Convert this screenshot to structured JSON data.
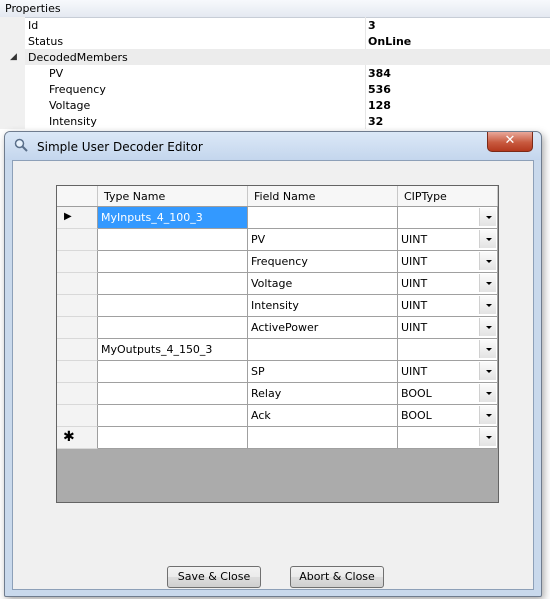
{
  "properties": {
    "header": "Properties",
    "rows": [
      {
        "name": "Id",
        "value": "3"
      },
      {
        "name": "Status",
        "value": "OnLine"
      },
      {
        "name": "DecodedMembers",
        "value": ""
      },
      {
        "name": "PV",
        "value": "384"
      },
      {
        "name": "Frequency",
        "value": "536"
      },
      {
        "name": "Voltage",
        "value": "128"
      },
      {
        "name": "Intensity",
        "value": "32"
      }
    ]
  },
  "dialog": {
    "title": "Simple User Decoder Editor",
    "close_label": "✕",
    "grid": {
      "columns": [
        "Type Name",
        "Field Name",
        "CIPType"
      ],
      "rows": [
        {
          "type_name": "MyInputs_4_100_3",
          "field_name": "",
          "cip_type": "",
          "marker": "▶"
        },
        {
          "type_name": "",
          "field_name": "PV",
          "cip_type": "UINT",
          "marker": ""
        },
        {
          "type_name": "",
          "field_name": "Frequency",
          "cip_type": "UINT",
          "marker": ""
        },
        {
          "type_name": "",
          "field_name": "Voltage",
          "cip_type": "UINT",
          "marker": ""
        },
        {
          "type_name": "",
          "field_name": "Intensity",
          "cip_type": "UINT",
          "marker": ""
        },
        {
          "type_name": "",
          "field_name": "ActivePower",
          "cip_type": "UINT",
          "marker": ""
        },
        {
          "type_name": "MyOutputs_4_150_3",
          "field_name": "",
          "cip_type": "",
          "marker": ""
        },
        {
          "type_name": "",
          "field_name": "SP",
          "cip_type": "UINT",
          "marker": ""
        },
        {
          "type_name": "",
          "field_name": "Relay",
          "cip_type": "BOOL",
          "marker": ""
        },
        {
          "type_name": "",
          "field_name": "Ack",
          "cip_type": "BOOL",
          "marker": ""
        },
        {
          "type_name": "",
          "field_name": "",
          "cip_type": "",
          "marker": "✱"
        }
      ]
    },
    "buttons": {
      "save_close": "Save & Close",
      "abort_close": "Abort & Close"
    }
  },
  "colors": {
    "selection": "#3399ff",
    "window_frame": "#c9d9ec",
    "close_button": "#c85a3f"
  }
}
